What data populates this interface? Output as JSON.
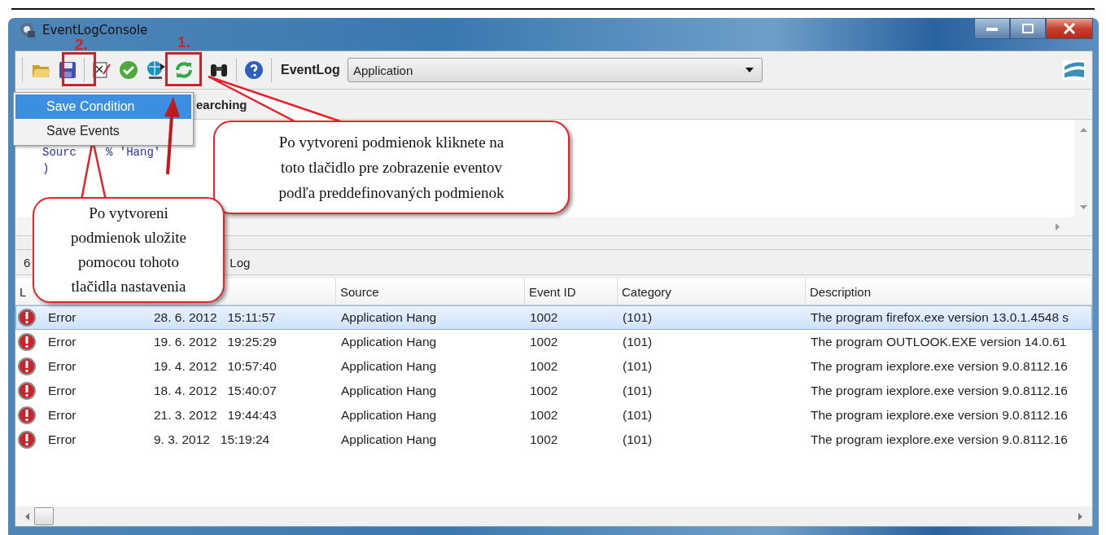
{
  "window": {
    "title": "EventLogConsole"
  },
  "toolbar": {
    "label": "EventLog",
    "combo_value": "Application"
  },
  "menu": [
    {
      "label": "Save Condition",
      "selected": true
    },
    {
      "label": "Save Events",
      "selected": false
    }
  ],
  "tab_label": "earching",
  "editor": {
    "lines": [
      [
        "Sourc",
        "% 'Hang'"
      ],
      [
        ")"
      ]
    ]
  },
  "status": [
    "6",
    "Log"
  ],
  "table": {
    "columns": [
      "L",
      "Source",
      "Event ID",
      "Category",
      "Description"
    ],
    "rows": [
      {
        "selected": true,
        "level": "Error",
        "date": "28. 6. 2012",
        "time": "15:11:57",
        "source": "Application Hang",
        "event_id": "1002",
        "category": "(101)",
        "description": "The program firefox.exe version 13.0.1.4548 s"
      },
      {
        "selected": false,
        "level": "Error",
        "date": "19. 6. 2012",
        "time": "19:25:29",
        "source": "Application Hang",
        "event_id": "1002",
        "category": "(101)",
        "description": "The program OUTLOOK.EXE version 14.0.61"
      },
      {
        "selected": false,
        "level": "Error",
        "date": "19. 4. 2012",
        "time": "10:57:40",
        "source": "Application Hang",
        "event_id": "1002",
        "category": "(101)",
        "description": "The program iexplore.exe version 9.0.8112.16"
      },
      {
        "selected": false,
        "level": "Error",
        "date": "18. 4. 2012",
        "time": "15:40:07",
        "source": "Application Hang",
        "event_id": "1002",
        "category": "(101)",
        "description": "The program iexplore.exe version 9.0.8112.16"
      },
      {
        "selected": false,
        "level": "Error",
        "date": "21. 3. 2012",
        "time": "19:44:43",
        "source": "Application Hang",
        "event_id": "1002",
        "category": "(101)",
        "description": "The program iexplore.exe version 9.0.8112.16"
      },
      {
        "selected": false,
        "level": "Error",
        "date": "9. 3. 2012",
        "time": "15:19:24",
        "source": "Application Hang",
        "event_id": "1002",
        "category": "(101)",
        "description": "The program iexplore.exe version 9.0.8112.16"
      }
    ]
  },
  "annotations": {
    "markers": [
      "2.",
      "1."
    ],
    "callouts": [
      {
        "kind": "run",
        "lines": [
          "Po vytvoreni podmienok kliknete na",
          "toto tlačidlo pre zobrazenie eventov",
          "podľa preddefinovaných podmienok"
        ]
      },
      {
        "kind": "save",
        "lines": [
          "Po vytvoreni",
          "podmienok uložite",
          "pomocou tohoto",
          "tlačidla nastavenia"
        ]
      }
    ]
  }
}
